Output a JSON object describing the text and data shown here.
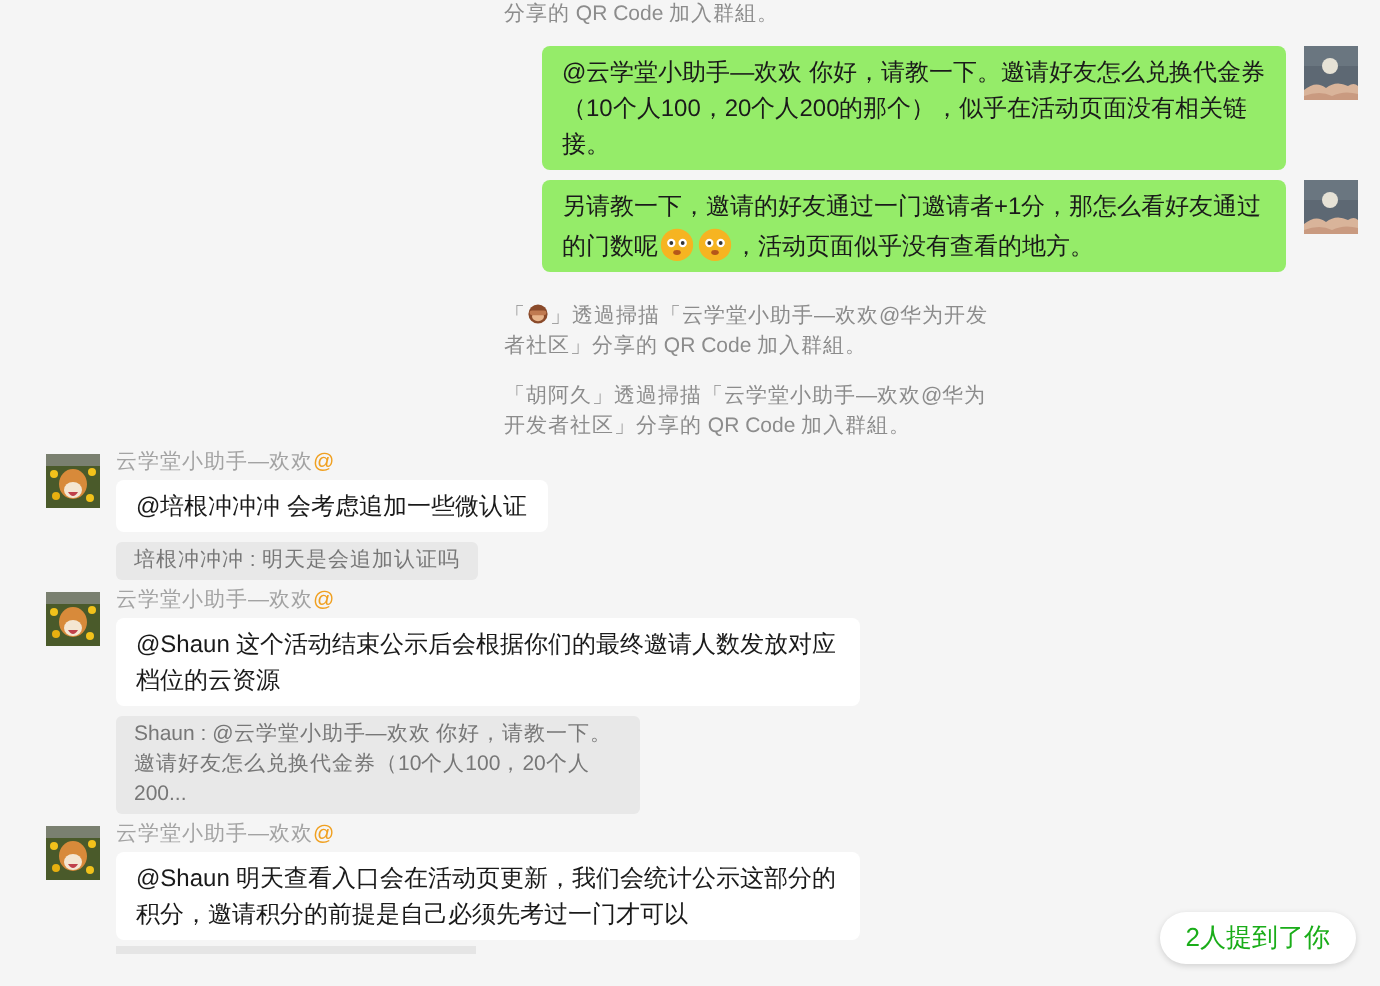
{
  "messages": [
    {
      "kind": "system",
      "text": "分享的 QR Code 加入群組。"
    },
    {
      "kind": "outgoing",
      "segments": [
        {
          "kind": "text",
          "text": "@云学堂小助手—欢欢 你好，请教一下。邀请好友怎么兑换代金券（10个人100，20个人200的那个），似乎在活动页面没有相关链接。"
        }
      ]
    },
    {
      "kind": "outgoing",
      "segments": [
        {
          "kind": "text",
          "text": "另请教一下，邀请的好友通过一门邀请者+1分，那怎么看好友通过的门数呢"
        },
        {
          "kind": "emoji"
        },
        {
          "kind": "emoji"
        },
        {
          "kind": "text",
          "text": "，活动页面似乎没有查看的地方。"
        }
      ]
    },
    {
      "kind": "system",
      "segments": [
        {
          "kind": "text",
          "text": "「"
        },
        {
          "kind": "emoji"
        },
        {
          "kind": "text",
          "text": "」透過掃描「云学堂小助手—欢欢@华为开发者社区」分享的 QR Code 加入群組。"
        }
      ]
    },
    {
      "kind": "system",
      "text": "「胡阿久」透過掃描「云学堂小助手—欢欢@华为开发者社区」分享的 QR Code 加入群組。"
    },
    {
      "kind": "incoming",
      "sender": "云学堂小助手—欢欢",
      "mention_mark": "@",
      "segments": [
        {
          "kind": "text",
          "text": "@培根冲冲冲 会考虑追加一些微认证"
        }
      ],
      "quote": "培根冲冲冲 : 明天是会追加认证吗"
    },
    {
      "kind": "incoming",
      "sender": "云学堂小助手—欢欢",
      "mention_mark": "@",
      "segments": [
        {
          "kind": "text",
          "text": "@Shaun 这个活动结束公示后会根据你们的最终邀请人数发放对应档位的云资源"
        }
      ],
      "quote": "Shaun : @云学堂小助手—欢欢 你好，请教一下。邀请好友怎么兑换代金券（10个人100，20个人200..."
    },
    {
      "kind": "incoming",
      "sender": "云学堂小助手—欢欢",
      "mention_mark": "@",
      "segments": [
        {
          "kind": "text",
          "text": "@Shaun 明天查看入口会在活动页更新，我们会统计公示这部分的积分，邀请积分的前提是自己必须先考过一门才可以"
        }
      ],
      "quote_partial": true
    }
  ],
  "mention_notice": "2人提到了你"
}
